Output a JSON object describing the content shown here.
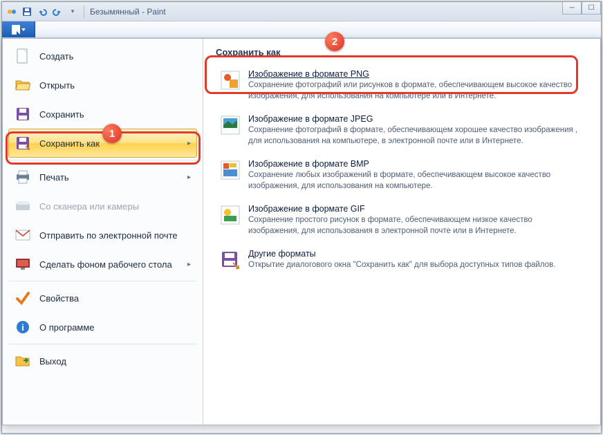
{
  "title": "Безымянный - Paint",
  "menu_left": {
    "create": "Создать",
    "open": "Открыть",
    "save": "Сохранить",
    "save_as": "Сохранить как",
    "print": "Печать",
    "scanner": "Со сканера или камеры",
    "email": "Отправить по электронной почте",
    "wallpaper": "Сделать фоном рабочего стола",
    "properties": "Свойства",
    "about": "О программе",
    "exit": "Выход"
  },
  "right_panel": {
    "title": "Сохранить как",
    "png": {
      "title": "Изображение в формате PNG",
      "desc": "Сохранение фотографий или рисунков в формате, обеспечивающем высокое качество изображения, для использования на компьютере или в Интернете."
    },
    "jpeg": {
      "title": "Изображение в формате JPEG",
      "desc": "Сохранение фотографий в формате, обеспечивающем хорошее качество изображения , для использования на компьютере, в электронной почте или в Интернете."
    },
    "bmp": {
      "title": "Изображение в формате BMP",
      "desc": "Сохранение любых изображений в формате, обеспечивающем высокое качество изображения, для использования на компьютере."
    },
    "gif": {
      "title": "Изображение в формате GIF",
      "desc": "Сохранение простого рисунок в формате, обеспечивающем низкое качество изображения, для использования в электронной почте или в Интернете."
    },
    "other": {
      "title": "Другие форматы",
      "desc": "Открытие диалогового окна \"Сохранить как\" для выбора доступных типов файлов."
    }
  },
  "badges": {
    "one": "1",
    "two": "2"
  }
}
